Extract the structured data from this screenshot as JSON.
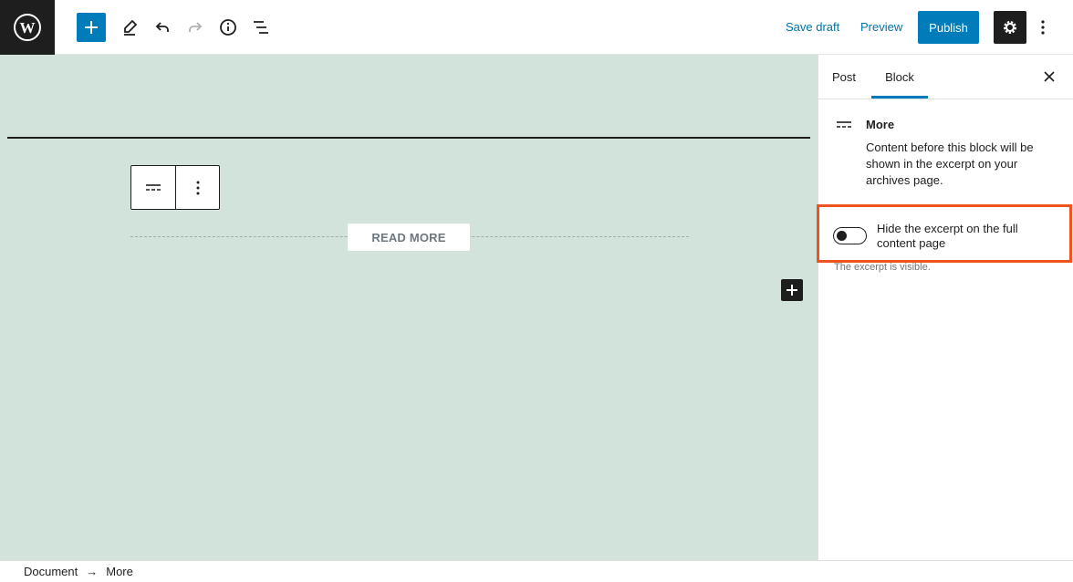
{
  "toolbar": {
    "logo_icon": "wordpress-logo-icon",
    "add_icon": "plus-icon",
    "tools_icon": "pencil-icon",
    "undo_icon": "undo-icon",
    "redo_icon": "redo-icon",
    "info_icon": "info-icon",
    "outline_icon": "list-view-icon",
    "save_draft_label": "Save draft",
    "preview_label": "Preview",
    "publish_label": "Publish",
    "settings_icon": "gear-icon",
    "more_icon": "kebab-icon"
  },
  "canvas": {
    "read_more_label": "READ MORE",
    "block_toolbar": {
      "block_icon": "more-block-icon",
      "options_icon": "kebab-icon"
    },
    "inserter_icon": "plus-icon"
  },
  "sidebar": {
    "tabs": [
      {
        "label": "Post",
        "active": false
      },
      {
        "label": "Block",
        "active": true
      }
    ],
    "close_icon": "close-icon",
    "block": {
      "title": "More",
      "description": "Content before this block will be shown in the excerpt on your archives page."
    },
    "toggle": {
      "label": "Hide the excerpt on the full content page",
      "checked": false,
      "help": "The excerpt is visible."
    }
  },
  "footer": {
    "breadcrumb": [
      "Document",
      "More"
    ],
    "separator": "→"
  },
  "colors": {
    "accent": "#007cba",
    "canvas_bg": "#d2e3dc",
    "highlight": "#f0541e",
    "dark": "#1e1e1e"
  }
}
